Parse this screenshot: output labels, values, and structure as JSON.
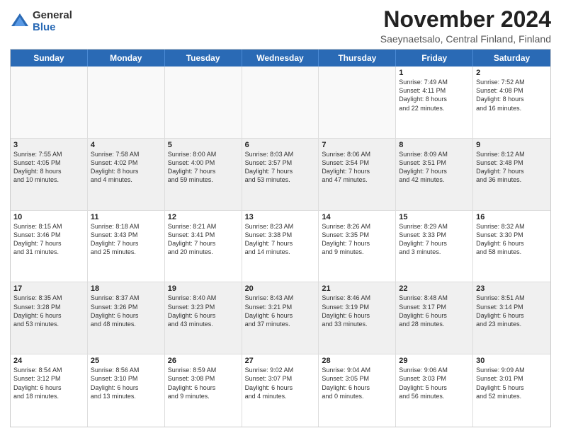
{
  "logo": {
    "general": "General",
    "blue": "Blue"
  },
  "title": "November 2024",
  "location": "Saeynaetsalo, Central Finland, Finland",
  "header_days": [
    "Sunday",
    "Monday",
    "Tuesday",
    "Wednesday",
    "Thursday",
    "Friday",
    "Saturday"
  ],
  "weeks": [
    [
      {
        "day": "",
        "detail": "",
        "empty": true
      },
      {
        "day": "",
        "detail": "",
        "empty": true
      },
      {
        "day": "",
        "detail": "",
        "empty": true
      },
      {
        "day": "",
        "detail": "",
        "empty": true
      },
      {
        "day": "",
        "detail": "",
        "empty": true
      },
      {
        "day": "1",
        "detail": "Sunrise: 7:49 AM\nSunset: 4:11 PM\nDaylight: 8 hours\nand 22 minutes."
      },
      {
        "day": "2",
        "detail": "Sunrise: 7:52 AM\nSunset: 4:08 PM\nDaylight: 8 hours\nand 16 minutes."
      }
    ],
    [
      {
        "day": "3",
        "detail": "Sunrise: 7:55 AM\nSunset: 4:05 PM\nDaylight: 8 hours\nand 10 minutes."
      },
      {
        "day": "4",
        "detail": "Sunrise: 7:58 AM\nSunset: 4:02 PM\nDaylight: 8 hours\nand 4 minutes."
      },
      {
        "day": "5",
        "detail": "Sunrise: 8:00 AM\nSunset: 4:00 PM\nDaylight: 7 hours\nand 59 minutes."
      },
      {
        "day": "6",
        "detail": "Sunrise: 8:03 AM\nSunset: 3:57 PM\nDaylight: 7 hours\nand 53 minutes."
      },
      {
        "day": "7",
        "detail": "Sunrise: 8:06 AM\nSunset: 3:54 PM\nDaylight: 7 hours\nand 47 minutes."
      },
      {
        "day": "8",
        "detail": "Sunrise: 8:09 AM\nSunset: 3:51 PM\nDaylight: 7 hours\nand 42 minutes."
      },
      {
        "day": "9",
        "detail": "Sunrise: 8:12 AM\nSunset: 3:48 PM\nDaylight: 7 hours\nand 36 minutes."
      }
    ],
    [
      {
        "day": "10",
        "detail": "Sunrise: 8:15 AM\nSunset: 3:46 PM\nDaylight: 7 hours\nand 31 minutes."
      },
      {
        "day": "11",
        "detail": "Sunrise: 8:18 AM\nSunset: 3:43 PM\nDaylight: 7 hours\nand 25 minutes."
      },
      {
        "day": "12",
        "detail": "Sunrise: 8:21 AM\nSunset: 3:41 PM\nDaylight: 7 hours\nand 20 minutes."
      },
      {
        "day": "13",
        "detail": "Sunrise: 8:23 AM\nSunset: 3:38 PM\nDaylight: 7 hours\nand 14 minutes."
      },
      {
        "day": "14",
        "detail": "Sunrise: 8:26 AM\nSunset: 3:35 PM\nDaylight: 7 hours\nand 9 minutes."
      },
      {
        "day": "15",
        "detail": "Sunrise: 8:29 AM\nSunset: 3:33 PM\nDaylight: 7 hours\nand 3 minutes."
      },
      {
        "day": "16",
        "detail": "Sunrise: 8:32 AM\nSunset: 3:30 PM\nDaylight: 6 hours\nand 58 minutes."
      }
    ],
    [
      {
        "day": "17",
        "detail": "Sunrise: 8:35 AM\nSunset: 3:28 PM\nDaylight: 6 hours\nand 53 minutes."
      },
      {
        "day": "18",
        "detail": "Sunrise: 8:37 AM\nSunset: 3:26 PM\nDaylight: 6 hours\nand 48 minutes."
      },
      {
        "day": "19",
        "detail": "Sunrise: 8:40 AM\nSunset: 3:23 PM\nDaylight: 6 hours\nand 43 minutes."
      },
      {
        "day": "20",
        "detail": "Sunrise: 8:43 AM\nSunset: 3:21 PM\nDaylight: 6 hours\nand 37 minutes."
      },
      {
        "day": "21",
        "detail": "Sunrise: 8:46 AM\nSunset: 3:19 PM\nDaylight: 6 hours\nand 33 minutes."
      },
      {
        "day": "22",
        "detail": "Sunrise: 8:48 AM\nSunset: 3:17 PM\nDaylight: 6 hours\nand 28 minutes."
      },
      {
        "day": "23",
        "detail": "Sunrise: 8:51 AM\nSunset: 3:14 PM\nDaylight: 6 hours\nand 23 minutes."
      }
    ],
    [
      {
        "day": "24",
        "detail": "Sunrise: 8:54 AM\nSunset: 3:12 PM\nDaylight: 6 hours\nand 18 minutes."
      },
      {
        "day": "25",
        "detail": "Sunrise: 8:56 AM\nSunset: 3:10 PM\nDaylight: 6 hours\nand 13 minutes."
      },
      {
        "day": "26",
        "detail": "Sunrise: 8:59 AM\nSunset: 3:08 PM\nDaylight: 6 hours\nand 9 minutes."
      },
      {
        "day": "27",
        "detail": "Sunrise: 9:02 AM\nSunset: 3:07 PM\nDaylight: 6 hours\nand 4 minutes."
      },
      {
        "day": "28",
        "detail": "Sunrise: 9:04 AM\nSunset: 3:05 PM\nDaylight: 6 hours\nand 0 minutes."
      },
      {
        "day": "29",
        "detail": "Sunrise: 9:06 AM\nSunset: 3:03 PM\nDaylight: 5 hours\nand 56 minutes."
      },
      {
        "day": "30",
        "detail": "Sunrise: 9:09 AM\nSunset: 3:01 PM\nDaylight: 5 hours\nand 52 minutes."
      }
    ]
  ]
}
